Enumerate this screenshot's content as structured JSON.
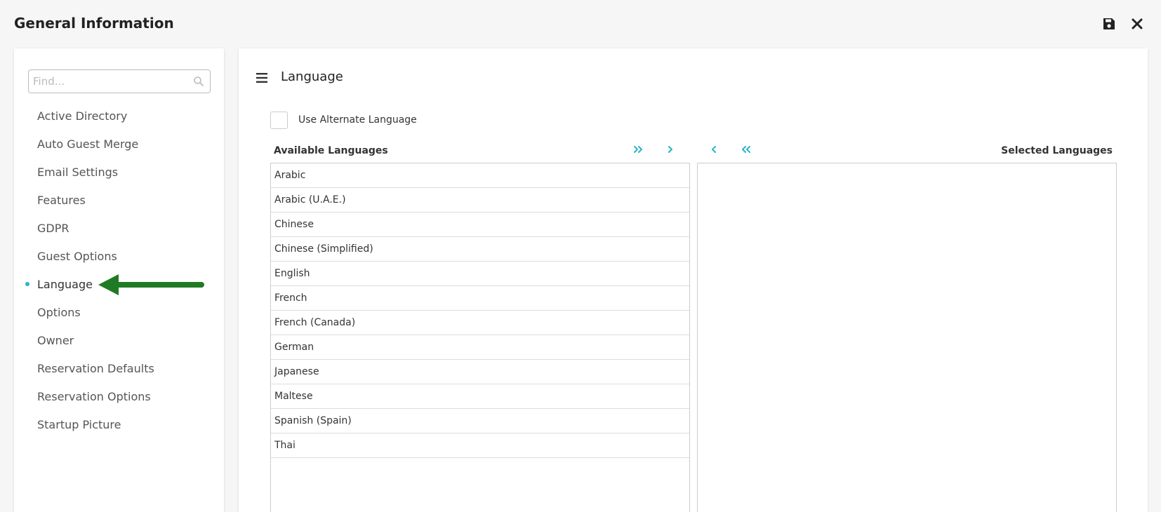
{
  "header": {
    "title": "General Information",
    "save_icon": "save-icon",
    "close_icon": "close-icon"
  },
  "sidebar": {
    "search_placeholder": "Find...",
    "items": [
      {
        "label": "Active Directory"
      },
      {
        "label": "Auto Guest Merge"
      },
      {
        "label": "Email Settings"
      },
      {
        "label": "Features"
      },
      {
        "label": "GDPR"
      },
      {
        "label": "Guest Options"
      },
      {
        "label": "Language",
        "active": true
      },
      {
        "label": "Options"
      },
      {
        "label": "Owner"
      },
      {
        "label": "Reservation Defaults"
      },
      {
        "label": "Reservation Options"
      },
      {
        "label": "Startup Picture"
      }
    ]
  },
  "main": {
    "title": "Language",
    "use_alternate_label": "Use Alternate Language",
    "use_alternate_checked": false,
    "available_header": "Available Languages",
    "selected_header": "Selected Languages",
    "available": [
      "Arabic",
      "Arabic (U.A.E.)",
      "Chinese",
      "Chinese (Simplified)",
      "English",
      "French",
      "French (Canada)",
      "German",
      "Japanese",
      "Maltese",
      "Spanish (Spain)",
      "Thai"
    ],
    "selected": []
  },
  "colors": {
    "accent": "#28b4c8",
    "annotation_arrow": "#1f7a24"
  }
}
